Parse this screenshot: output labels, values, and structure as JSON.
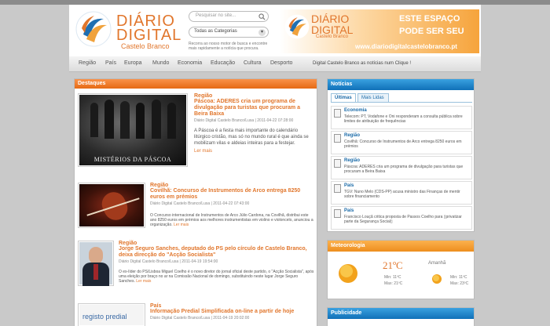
{
  "header": {
    "logo_line1": "DIÁRIO",
    "logo_line2": "DIGITAL",
    "logo_line3": "Castelo Branco",
    "search_placeholder": "Pesquisar no site...",
    "category_select": "Todas as Categorias",
    "search_help": "Recorra ao nosso motor de busca e encontre mais rapidamente a notícia que procura."
  },
  "banner": {
    "logo_line1": "DIÁRIO",
    "logo_line2": "DIGITAL",
    "logo_line3": "Castelo Branco",
    "headline1": "ESTE ESPAÇO",
    "headline2": "PODE SER SEU",
    "url": "www.diariodigitalcastelobranco.pt"
  },
  "nav": {
    "items": [
      "Região",
      "País",
      "Europa",
      "Mundo",
      "Economia",
      "Educação",
      "Cultura",
      "Desporto"
    ],
    "ticker": "Digital Castelo Branco as notícias num Clique !"
  },
  "destaques": {
    "title": "Destaques",
    "articles": [
      {
        "category": "Região",
        "title": "Páscoa: ADERES cria um programa de divulgação para turistas que procuram a Beira Baixa",
        "meta": "Diário Digital Castelo Branco/Lusa | 2011-04-22 07:28:00",
        "body": "A Páscoa é a festa mais importante do calendário litúrgico cristão, mas só no mundo rural é que ainda se mobilizam vilas e aldeias inteiras para a festejar.",
        "more": "Ler mais",
        "image_caption": "MISTÉRIOS DA PÁSCOA"
      },
      {
        "category": "Região",
        "title": "Covilhã: Concurso de Instrumentos de Arco entrega 8250 euros em prémios",
        "meta": "Diário Digital Castelo Branco/Lusa | 2011-04-22 07:43:00",
        "body": "O Concurso internacional de Instrumentos de Arco Júlio Cardona, na Covilhã, distribui este ano 8250 euros em prémios aos melhores instrumentistas em violino e violoncelo, anunciou a organização.",
        "more": "Ler mais"
      },
      {
        "category": "Região",
        "title": "Jorge Seguro Sanches, deputado do PS pelo círculo de Castelo Branco, deixa direcção do \"Acção Socialista\"",
        "meta": "Diário Digital Castelo Branco/Lusa | 2011-04-19 19:54:00",
        "body": "O ex-líder do PS/Lisboa Miguel Coelho é o novo diretor do jornal oficial deste partido, o \"Acção Socialista\", após uma eleição por braço no ar na Comissão Nacional de domingo, substituindo neste lugar Jorge Seguro Sanches.",
        "more": "Ler mais"
      },
      {
        "category": "País",
        "title": "Informação Predial Simplificada on-line a partir de hoje",
        "meta": "Diário Digital Castelo Branco/Lusa | 2011-04-19 20:02:00",
        "image_caption": "registo predial"
      }
    ]
  },
  "noticias": {
    "title": "Notícias",
    "tabs": [
      "Últimas",
      "Mais Lidas"
    ],
    "items": [
      {
        "category": "Economia",
        "text": "Telecom: PT, Vodafone e Oni responderam a consulta pública sobre limites de atribuição de frequências"
      },
      {
        "category": "Região",
        "text": "Covilhã: Concurso de Instrumentos de Arco entrega 8250 euros em prémios"
      },
      {
        "category": "Região",
        "text": "Páscoa: ADERES cria um programa de divulgação para turistas que procuram a Beira Baixa"
      },
      {
        "category": "País",
        "text": "TGV: Nuno Melo (CDS-PP) acusa ministro das Finanças de mentir sobre financiamento"
      },
      {
        "category": "País",
        "text": "Francisco Louçã critica proposta de Passos Coelho para ▯privatizar parte da Segurança Social▯"
      }
    ]
  },
  "meteo": {
    "title": "Meteorologia",
    "today_temp": "21ºC",
    "today_min": "Min: 11ºC",
    "today_max": "Max: 21ºC",
    "tomorrow_label": "Amanhã",
    "tomorrow_min": "Min: 11ºC",
    "tomorrow_max": "Max: 23ºC"
  },
  "publicidade": {
    "title": "Publicidade"
  }
}
